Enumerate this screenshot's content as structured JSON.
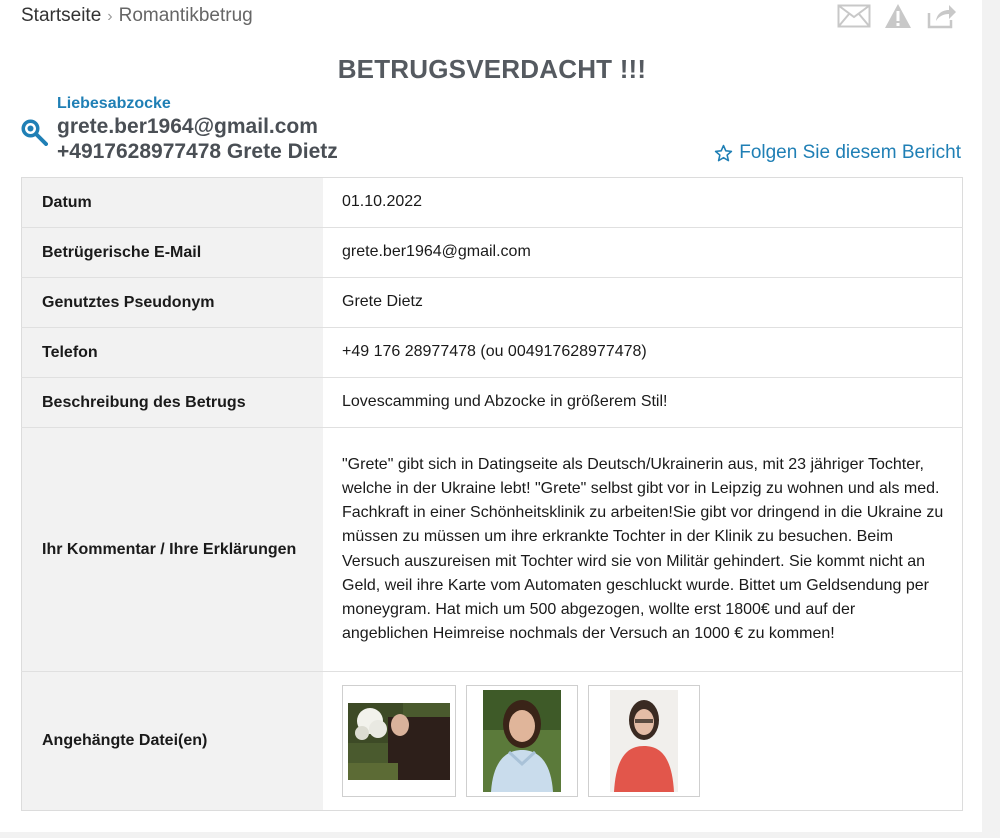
{
  "breadcrumb": {
    "home": "Startseite",
    "separator": "›",
    "current": "Romantikbetrug"
  },
  "top_actions": {
    "icons": [
      "envelope-icon",
      "warning-icon",
      "share-icon"
    ]
  },
  "title": "BETRUGSVERDACHT !!!",
  "scam": {
    "category": "Liebesabzocke",
    "email": "grete.ber1964@gmail.com",
    "phone_name": "+4917628977478 Grete Dietz",
    "icon": "magnifier-icon"
  },
  "follow": {
    "label": "Folgen Sie diesem Bericht",
    "icon": "star-outline-icon"
  },
  "details": {
    "date_label": "Datum",
    "date_value": "01.10.2022",
    "email_label": "Betrügerische E-Mail",
    "email_value": "grete.ber1964@gmail.com",
    "pseudonym_label": "Genutztes Pseudonym",
    "pseudonym_value": "Grete Dietz",
    "phone_label": "Telefon",
    "phone_value": "+49 176 28977478 (ou 004917628977478)",
    "description_label": "Beschreibung des Betrugs",
    "description_value": "Lovescamming und Abzocke in größerem Stil!",
    "comment_label": "Ihr Kommentar / Ihre Erklärungen",
    "comment_value": "\"Grete\" gibt sich in Datingseite als Deutsch/Ukrainerin aus, mit 23 jähriger Tochter, welche in der Ukraine lebt! \"Grete\" selbst gibt vor in Leipzig zu wohnen und als med. Fachkraft in einer Schönheitsklinik zu arbeiten!Sie gibt vor dringend in die Ukraine zu müssen zu müssen um ihre erkrankte Tochter in der Klinik zu besuchen. Beim Versuch auszureisen mit Tochter wird sie von Militär gehindert. Sie kommt nicht an Geld, weil ihre Karte vom Automaten geschluckt wurde. Bittet um Geldsendung per moneygram. Hat mich um 500 abgezogen, wollte erst 1800€ und auf der angeblichen Heimreise nochmals der Versuch an 1000 € zu kommen!",
    "attachments_label": "Angehängte Datei(en)",
    "attachments_count": 3
  },
  "colors": {
    "accent": "#1f7fb5",
    "title": "#555a60",
    "label_bg": "#f2f2f2",
    "icon_gray": "#c8c8c8"
  }
}
